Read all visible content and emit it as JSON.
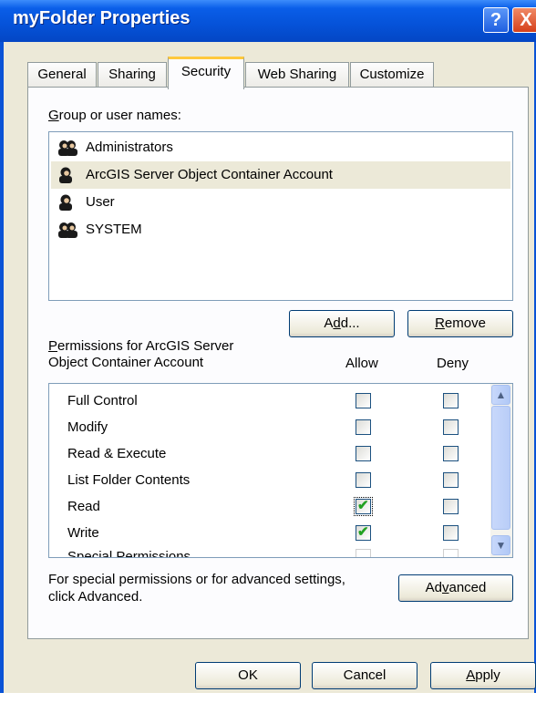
{
  "window": {
    "title": "myFolder Properties",
    "help_label": "?",
    "close_label": "X"
  },
  "tabs": [
    {
      "label": "General"
    },
    {
      "label": "Sharing"
    },
    {
      "label": "Security",
      "active": true
    },
    {
      "label": "Web Sharing"
    },
    {
      "label": "Customize"
    }
  ],
  "security": {
    "group_label_first": "G",
    "group_label_rest": "roup or user names:",
    "users": [
      {
        "name": "Administrators",
        "icon": "user-group-icon"
      },
      {
        "name": "ArcGIS Server Object Container Account",
        "icon": "user-icon",
        "selected": true
      },
      {
        "name": "User",
        "icon": "user-icon"
      },
      {
        "name": "SYSTEM",
        "icon": "user-group-icon"
      }
    ],
    "add_label_pre": "A",
    "add_label_u": "d",
    "add_label_post": "d...",
    "remove_label_u": "R",
    "remove_label_post": "emove",
    "permissions_label_u": "P",
    "permissions_label_line1": "ermissions for ArcGIS Server",
    "permissions_label_line2": "Object Container Account",
    "allow_header": "Allow",
    "deny_header": "Deny",
    "permissions": [
      {
        "name": "Full Control",
        "allow": false,
        "deny": false
      },
      {
        "name": "Modify",
        "allow": false,
        "deny": false
      },
      {
        "name": "Read & Execute",
        "allow": false,
        "deny": false
      },
      {
        "name": "List Folder Contents",
        "allow": false,
        "deny": false
      },
      {
        "name": "Read",
        "allow": true,
        "deny": false,
        "focused": true
      },
      {
        "name": "Write",
        "allow": true,
        "deny": false
      },
      {
        "name": "Special Permissions",
        "allow": false,
        "deny": false,
        "partial": true
      }
    ],
    "special_line1": "For special permissions or for advanced settings,",
    "special_line2": "click Advanced.",
    "advanced_pre": "Ad",
    "advanced_u": "v",
    "advanced_post": "anced"
  },
  "footer": {
    "ok_label": "OK",
    "cancel_label": "Cancel",
    "apply_u": "A",
    "apply_post": "pply"
  },
  "colors": {
    "titlebar": "#0552d8",
    "window_bg": "#ece9d8",
    "check_green": "#21a121",
    "tab_highlight": "#ffc83c"
  }
}
